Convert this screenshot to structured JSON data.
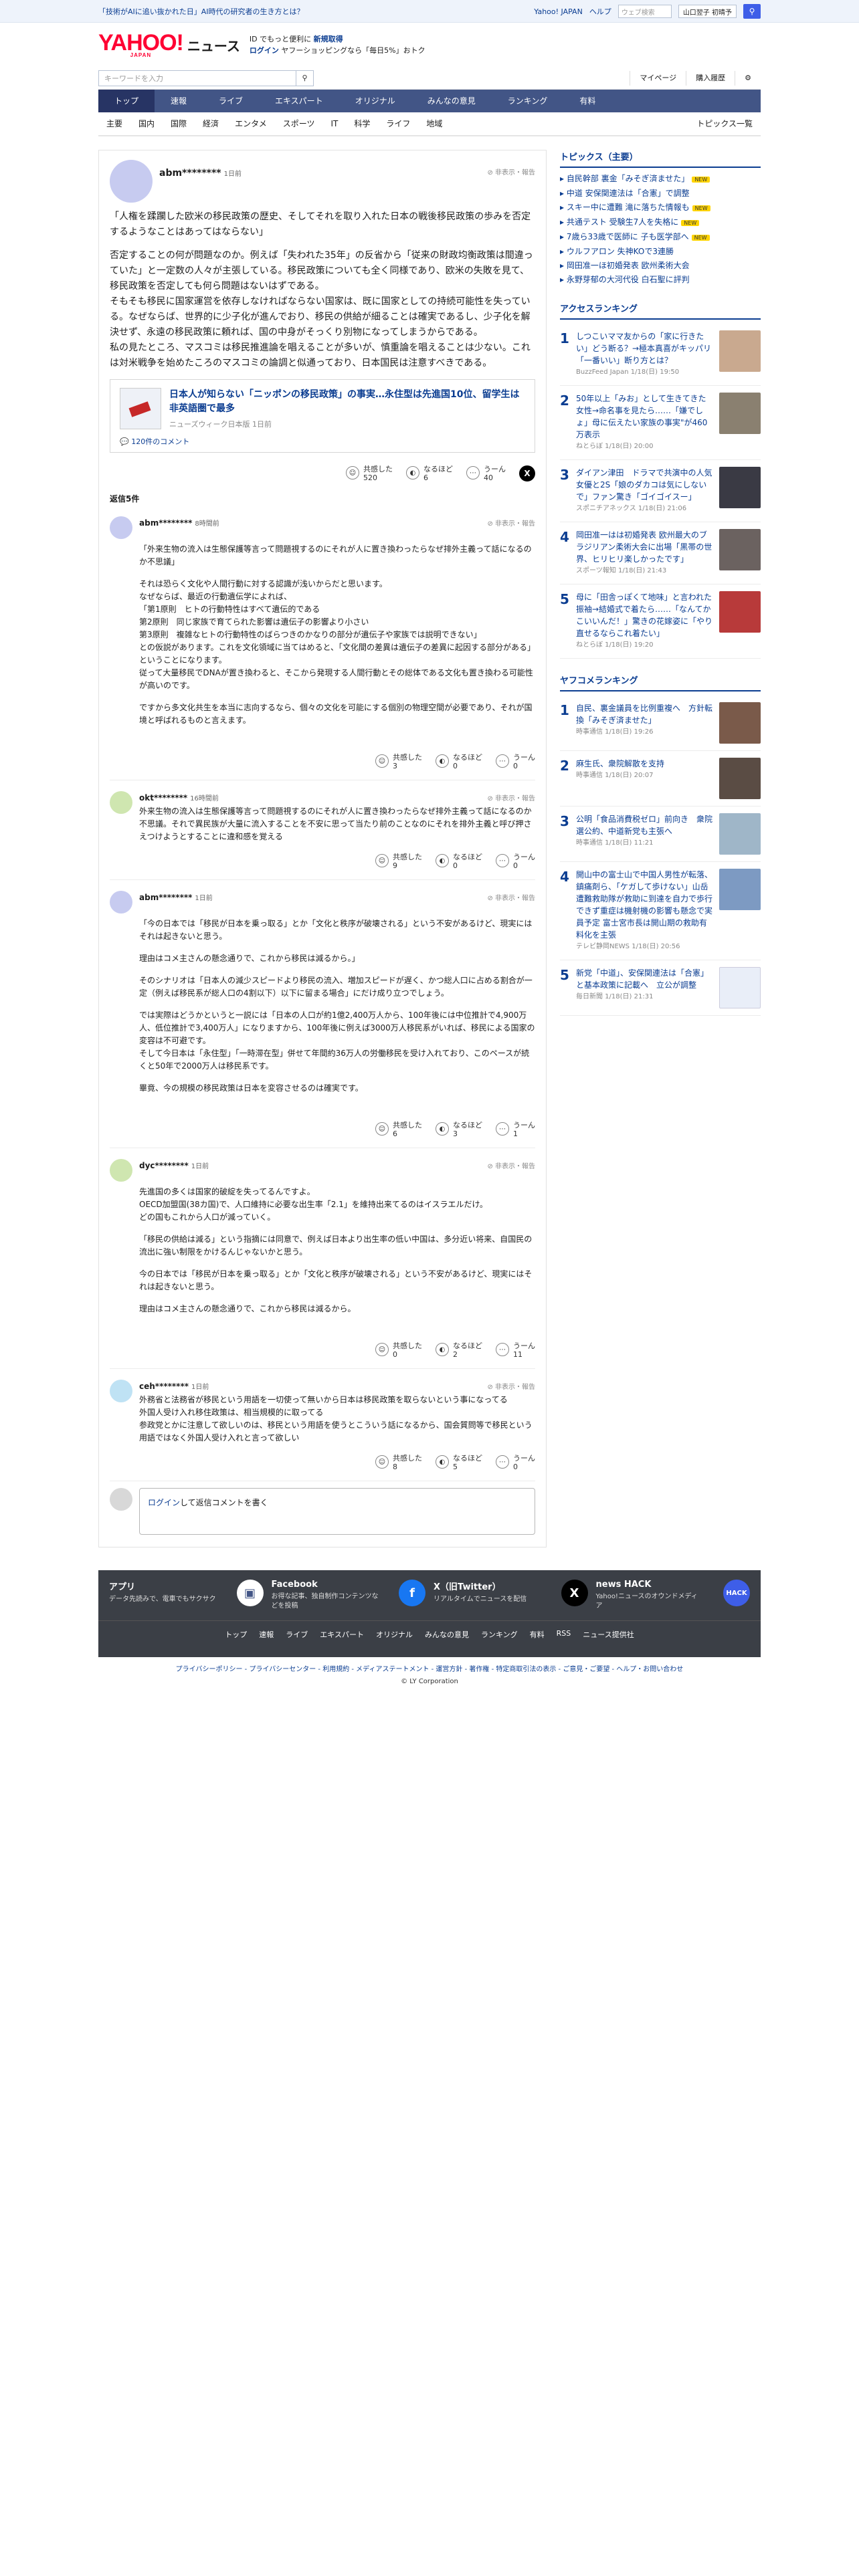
{
  "promo": {
    "text": "「技術がAIに追い抜かれた日」AI時代の研究者の生き方とは？"
  },
  "topnav": {
    "yahoo": "Yahoo! JAPAN",
    "help": "ヘルプ",
    "search_placeholder": "ウェブ検索",
    "weather": "山口翌子 初晴予",
    "search_icon": "search-icon"
  },
  "header": {
    "logo": "YAHOO!",
    "logo_sub": "JAPAN",
    "news": "ニュース",
    "line1": "ID でもっと便利に",
    "line1_link": "新規取得",
    "line2_link": "ログイン",
    "line2": "ヤフーショッピングなら「毎日5%」おトク"
  },
  "subbar": {
    "keyword_placeholder": "キーワードを入力",
    "mypage": "マイページ",
    "history": "購入履歴"
  },
  "gnav": [
    "トップ",
    "速報",
    "ライブ",
    "エキスパート",
    "オリジナル",
    "みんなの意見",
    "ランキング",
    "有料"
  ],
  "cnav": [
    "主要",
    "国内",
    "国際",
    "経済",
    "エンタメ",
    "スポーツ",
    "IT",
    "科学",
    "ライフ",
    "地域"
  ],
  "cnav_all": "トピックス一覧",
  "comment": {
    "user": "abm********",
    "time": "1日前",
    "report": "非表示・報告",
    "paragraphs": [
      "「人権を蹂躙した欧米の移民政策の歴史、そしてそれを取り入れた日本の戦後移民政策の歩みを否定するようなことはあってはならない」",
      "否定することの何が問題なのか。例えば「失われた35年」の反省から「従来の財政均衡政策は間違っていた」と一定数の人々が主張している。移民政策についても全く同様であり、欧米の失敗を見て、移民政策を否定しても何ら問題はないはずである。\nそもそも移民に国家運営を依存しなければならない国家は、既に国家としての持続可能性を失っている。なぜならば、世界的に少子化が進んでおり、移民の供給が細ることは確実であるし、少子化を解決せず、永遠の移民政策に頼れば、国の中身がそっくり別物になってしまうからである。\n私の見たところ、マスコミは移民推進論を唱えることが多いが、慎重論を唱えることは少ない。これは対米戦争を始めたころのマスコミの論調と似通っており、日本国民は注意すべきである。"
    ],
    "card": {
      "title": "日本人が知らない「ニッポンの移民政策」の事実…永住型は先進国10位、留学生は非英語圏で最多",
      "source": "ニューズウィーク日本版 1日前",
      "comments": "120件のコメント"
    },
    "reactions": {
      "empathy_label": "共感した",
      "empathy": "520",
      "insight_label": "なるほど",
      "insight": "6",
      "hmm_label": "うーん",
      "hmm": "40"
    }
  },
  "replies_title": "返信5件",
  "replies": [
    {
      "user": "abm********",
      "time": "8時間前",
      "report": "非表示・報告",
      "text": [
        "「外来生物の流入は生態保護等言って問題視するのにそれが人に置き換わったらなぜ排外主義って話になるのか不思議」",
        "それは恐らく文化や人間行動に対する認識が浅いからだと思います。\nなぜならば、最近の行動遺伝学によれば、\n「第1原則　ヒトの行動特性はすべて遺伝的である\n第2原則　同じ家族で育てられた影響は遺伝子の影響より小さい\n第3原則　複雑なヒトの行動特性のばらつきのかなりの部分が遺伝子や家族では説明できない」\nとの仮説があります。これを文化領域に当てはめると、「文化間の差異は遺伝子の差異に起因する部分がある」ということになります。\n従って大量移民でDNAが置き換わると、そこから発現する人間行動とその総体である文化も置き換わる可能性が高いのです。",
        "ですから多文化共生を本当に志向するなら、個々の文化を可能にする個別の物理空間が必要であり、それが国境と呼ばれるものと言えます。"
      ],
      "empathy": "3",
      "insight": "0",
      "hmm": "0"
    },
    {
      "user": "okt********",
      "time": "16時間前",
      "report": "非表示・報告",
      "text": [
        "外来生物の流入は生態保護等言って問題視するのにそれが人に置き換わったらなぜ排外主義って話になるのか不思議。それで異民族が大量に流入することを不安に思って当たり前のことなのにそれを排外主義と呼び押さえつけようとすることに違和感を覚える"
      ],
      "empathy": "9",
      "insight": "0",
      "hmm": "0"
    },
    {
      "user": "abm********",
      "time": "1日前",
      "report": "非表示・報告",
      "text": [
        "「今の日本では「移民が日本を乗っ取る」とか「文化と秩序が破壊される」という不安があるけど、現実にはそれは起きないと思う。",
        "理由はコメ主さんの懸念通りで、これから移民は減るから。」",
        "そのシナリオは「日本人の減少スピードより移民の流入、増加スピードが遅く、かつ総人口に占める割合が一定（例えば移民系が総人口の4割以下）以下に留まる場合」にだけ成り立つでしょう。",
        "では実際はどうかというと一説には「日本の人口が約1億2,400万人から、100年後には中位推計で4,900万人、低位推計で3,400万人」になりますから、100年後に例えば3000万人移民系がいれば、移民による国家の変容は不可避です。\nそして今日本は「永住型」「一時滞在型」併せて年間約36万人の労働移民を受け入れており、このペースが続くと50年で2000万人は移民系です。",
        "畢竟、今の規模の移民政策は日本を変容させるのは確実です。"
      ],
      "empathy": "6",
      "insight": "3",
      "hmm": "1"
    },
    {
      "user": "dyc********",
      "time": "1日前",
      "report": "非表示・報告",
      "text": [
        "先進国の多くは国家的破綻を失ってるんですよ。\nOECD加盟国(38カ国)で、人口維持に必要な出生率「2.1」を維持出来てるのはイスラエルだけ。\nどの国もこれから人口が減っていく。",
        "「移民の供給は減る」という指摘には同意で、例えば日本より出生率の低い中国は、多分近い将来、自国民の流出に強い制限をかけるんじゃないかと思う。",
        "今の日本では「移民が日本を乗っ取る」とか「文化と秩序が破壊される」という不安があるけど、現実にはそれは起きないと思う。",
        "理由はコメ主さんの懸念通りで、これから移民は減るから。"
      ],
      "empathy": "0",
      "insight": "2",
      "hmm": "11"
    },
    {
      "user": "ceh********",
      "time": "1日前",
      "report": "非表示・報告",
      "text": [
        "外務省と法務省が移民という用語を一切使って無いから日本は移民政策を取らないという事になってる\n外国人受け入れ移住政策は、相当規模的に取ってる\n参政党とかに注意して欲しいのは、移民という用語を使うとこういう話になるから、国会質問等で移民という用語ではなく外国人受け入れと言って欲しい"
      ],
      "empathy": "8",
      "insight": "5",
      "hmm": "0"
    }
  ],
  "write": {
    "login": "ログイン",
    "text": "して返信コメントを書く"
  },
  "topics": {
    "title": "トピックス（主要）",
    "items": [
      {
        "t": "自民幹部 裏金「みそぎ済ませた」",
        "n": "NEW"
      },
      {
        "t": "中道 安保関連法は「合憲」で調整",
        "n": ""
      },
      {
        "t": "スキー中に遭難 滝に落ちた情報も",
        "n": "NEW"
      },
      {
        "t": "共通テスト 受験生7人を失格に",
        "n": "NEW"
      },
      {
        "t": "7歳ら33歳で医師に 子も医学部へ",
        "n": "NEW"
      },
      {
        "t": "ウルフアロン 失神KOで3連勝",
        "n": ""
      },
      {
        "t": "岡田准一ほ初婚発表 欧州柔術大会",
        "n": ""
      },
      {
        "t": "永野芽郁の大河代役 白石聖に評判",
        "n": ""
      }
    ]
  },
  "access": {
    "title": "アクセスランキング",
    "items": [
      {
        "t": "しつこいママ友からの「家に行きたい」どう断る？→極本真喜がキッパリ「一番いい」断り方とは？",
        "m": "BuzzFeed Japan 1/18(日) 19:50"
      },
      {
        "t": "50年以上「みお」として生きてきた女性→命名事を見たら……「嫌でしょ」母に伝えたい家族の事実\"が460万表示",
        "m": "ねとらぼ 1/18(日) 20:00"
      },
      {
        "t": "ダイアン津田　ドラマで共演中の人気女優と2S「娘のダカコは気にしないで」ファン驚き「ゴイゴイスー」",
        "m": "スポニチアネックス 1/18(日) 21:06"
      },
      {
        "t": "岡田准一はは初婚発表 欧州最大のブラジリアン柔術大会に出場「黒帯の世界、ヒリヒリ楽しかったです」",
        "m": "スポーツ報知 1/18(日) 21:43"
      },
      {
        "t": "母に「田舎っぽくて地味」と言われた振袖→結婚式で着たら……「なんてかこいいんだ！」驚きの花嫁姿に「やり直せるならこれ着たい」",
        "m": "ねとらぼ 1/18(日) 19:20"
      }
    ]
  },
  "yafoo": {
    "title": "ヤフコメランキング",
    "items": [
      {
        "t": "自民、裏金議員を比例重複へ　方針転換「みそぎ済ませた」",
        "m": "時事通信 1/18(日) 19:26"
      },
      {
        "t": "麻生氏、衆院解散を支持",
        "m": "時事通信 1/18(日) 20:07"
      },
      {
        "t": "公明「食品消費税ゼロ」前向き　衆院選公約、中道新党も主張へ",
        "m": "時事通信 1/18(日) 11:21"
      },
      {
        "t": "開山中の富士山で中国人男性が転落、鎮痛剤ら、「ケガして歩けない」山岳遭難救助隊が救助に到達を自力で歩行できず重症は機射機の影響も懸念で実員予定 富士宮市長は開山期の救助有料化を主張",
        "m": "テレビ静岡NEWS 1/18(日) 20:56"
      },
      {
        "t": "新党「中道」、安保関連法は「合憲」と基本政策に記載へ　立公が調整",
        "m": "毎日新聞 1/18(日) 21:31"
      }
    ]
  },
  "footer": {
    "cards": [
      {
        "t": "アプリ",
        "d": "データ先読みで、電車でもサクサク"
      },
      {
        "t": "Facebook",
        "d": "お得な記事、独自制作コンテンツなどを投稿"
      },
      {
        "t": "X（旧Twitter）",
        "d": "リアルタイムでニュースを配信"
      },
      {
        "t": "news HACK",
        "d": "Yahoo!ニュースのオウンドメディア"
      }
    ],
    "links": [
      "トップ",
      "速報",
      "ライブ",
      "エキスパート",
      "オリジナル",
      "みんなの意見",
      "ランキング",
      "有料",
      "RSS",
      "ニュース提供社"
    ],
    "legal": "プライバシーポリシー - プライバシーセンター - 利用規約 - メディアステートメント - 運営方針 - 著作権 - 特定商取引法の表示 - ご意見・ご要望 - ヘルプ・お問い合わせ",
    "copyright": "© LY Corporation"
  },
  "colors": {
    "brand": "#ff0033",
    "nav": "#425586",
    "link": "#0b3d91"
  }
}
